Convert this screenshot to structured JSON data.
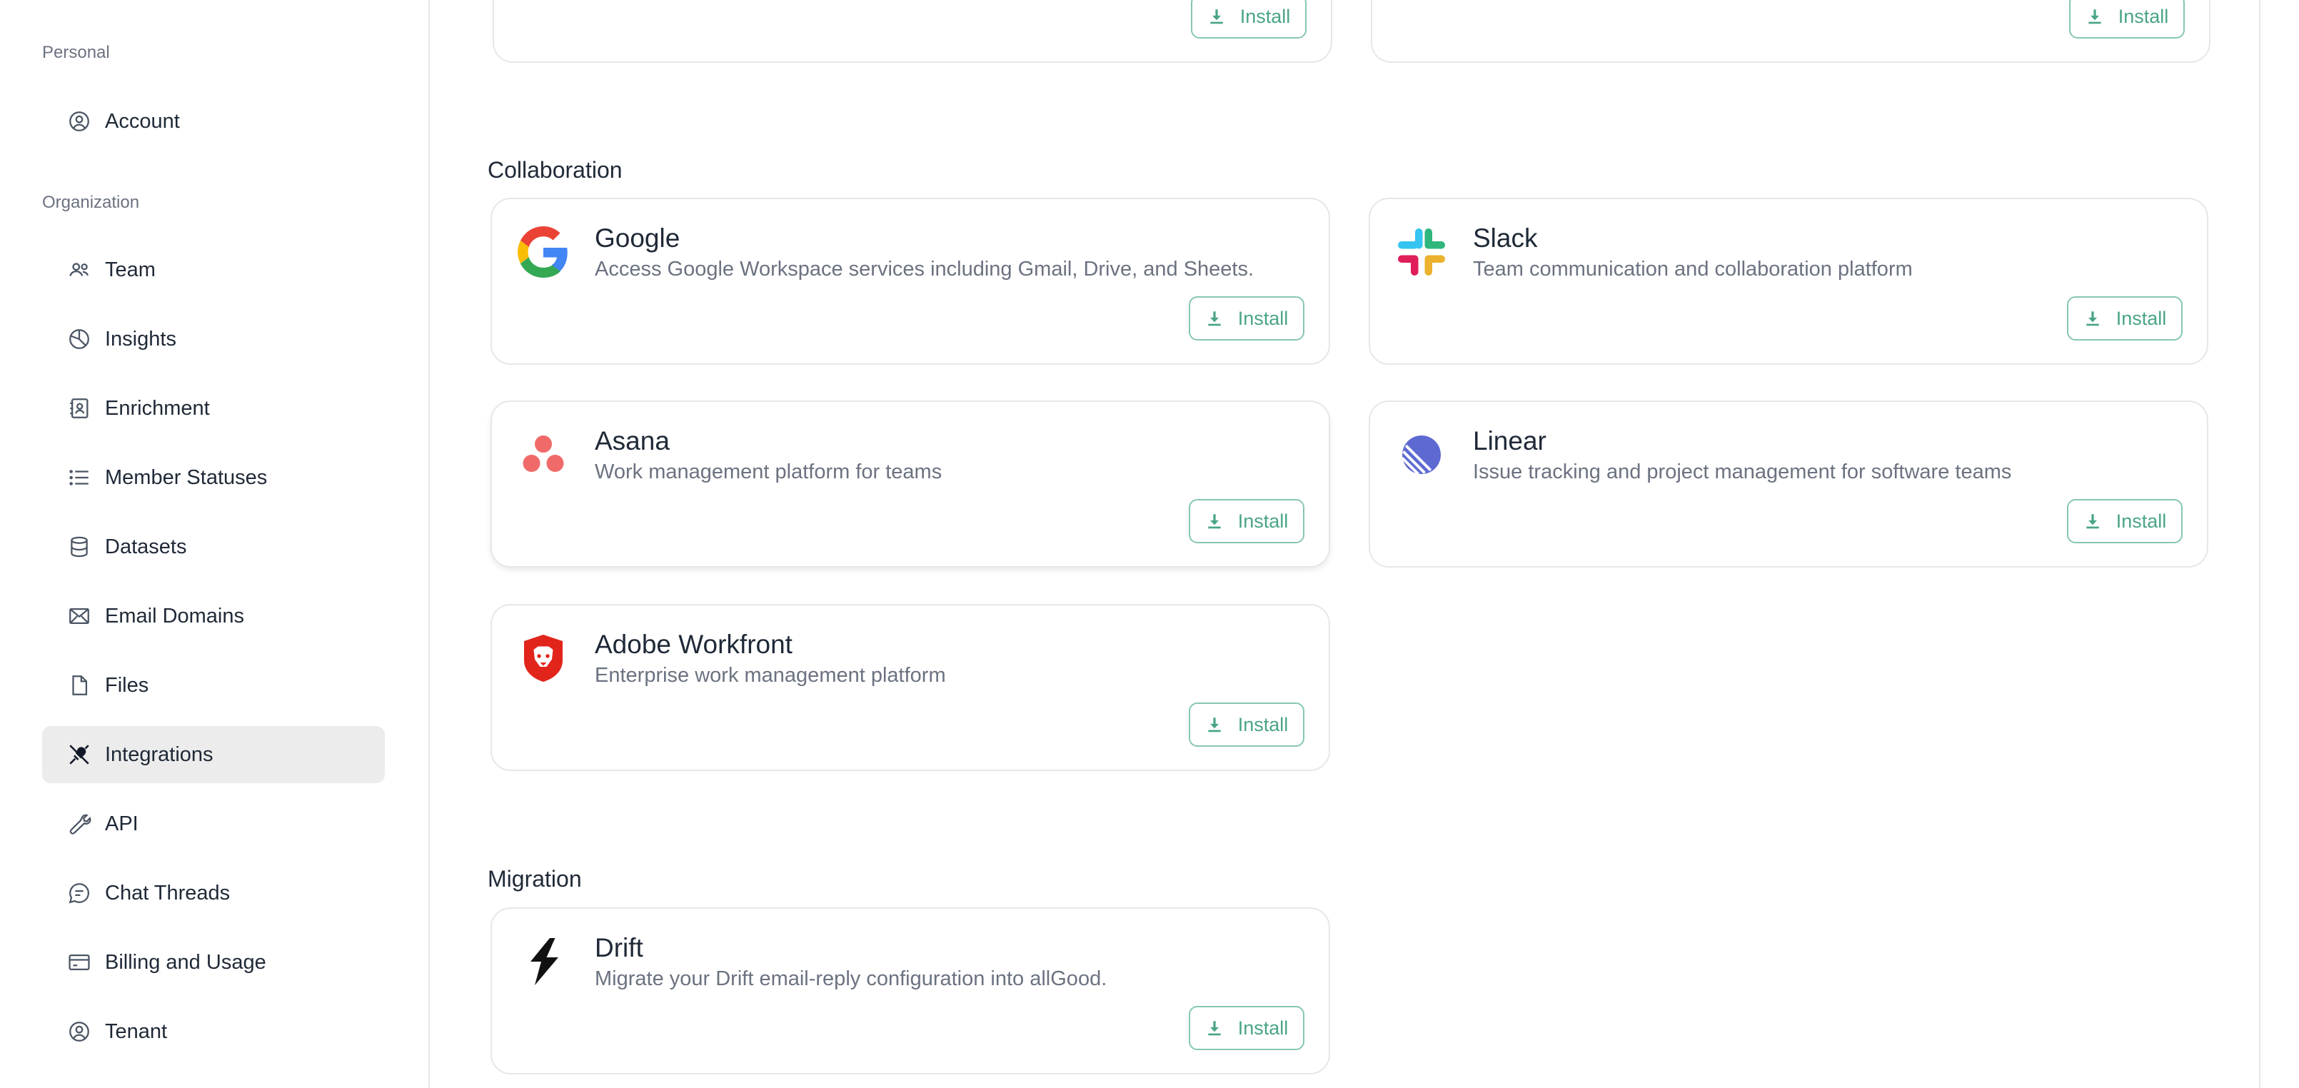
{
  "sidebar": {
    "sections": [
      {
        "label": "Personal"
      },
      {
        "label": "Organization"
      }
    ],
    "items": [
      {
        "label": "Account",
        "icon": "user-circle-icon"
      },
      {
        "label": "Team",
        "icon": "users-icon"
      },
      {
        "label": "Insights",
        "icon": "pie-chart-icon"
      },
      {
        "label": "Enrichment",
        "icon": "contact-card-icon"
      },
      {
        "label": "Member Statuses",
        "icon": "list-icon"
      },
      {
        "label": "Datasets",
        "icon": "database-icon"
      },
      {
        "label": "Email Domains",
        "icon": "mail-icon"
      },
      {
        "label": "Files",
        "icon": "file-icon"
      },
      {
        "label": "Integrations",
        "icon": "plug-icon",
        "active": true
      },
      {
        "label": "API",
        "icon": "wrench-icon"
      },
      {
        "label": "Chat Threads",
        "icon": "chat-icon"
      },
      {
        "label": "Billing and Usage",
        "icon": "credit-card-icon"
      },
      {
        "label": "Tenant",
        "icon": "user-circle-icon"
      }
    ]
  },
  "main": {
    "top_partial_cards": [
      {
        "install_label": "Install"
      },
      {
        "install_label": "Install"
      }
    ],
    "groups": [
      {
        "title": "Collaboration",
        "cards": [
          {
            "title": "Google",
            "description": "Access Google Workspace services including Gmail, Drive, and Sheets.",
            "install_label": "Install",
            "icon": "google-logo-icon"
          },
          {
            "title": "Slack",
            "description": "Team communication and collaboration platform",
            "install_label": "Install",
            "icon": "slack-logo-icon"
          },
          {
            "title": "Asana",
            "description": "Work management platform for teams",
            "install_label": "Install",
            "icon": "asana-logo-icon"
          },
          {
            "title": "Linear",
            "description": "Issue tracking and project management for software teams",
            "install_label": "Install",
            "icon": "linear-logo-icon"
          },
          {
            "title": "Adobe Workfront",
            "description": "Enterprise work management platform",
            "install_label": "Install",
            "icon": "adobe-workfront-logo-icon"
          }
        ]
      },
      {
        "title": "Migration",
        "cards": [
          {
            "title": "Drift",
            "description": "Migrate your Drift email-reply configuration into allGood.",
            "install_label": "Install",
            "icon": "drift-logo-icon"
          }
        ]
      }
    ]
  },
  "colors": {
    "install_border": "#86c8ad",
    "install_text": "#4aa584",
    "active_item_bg": "#ececec"
  }
}
